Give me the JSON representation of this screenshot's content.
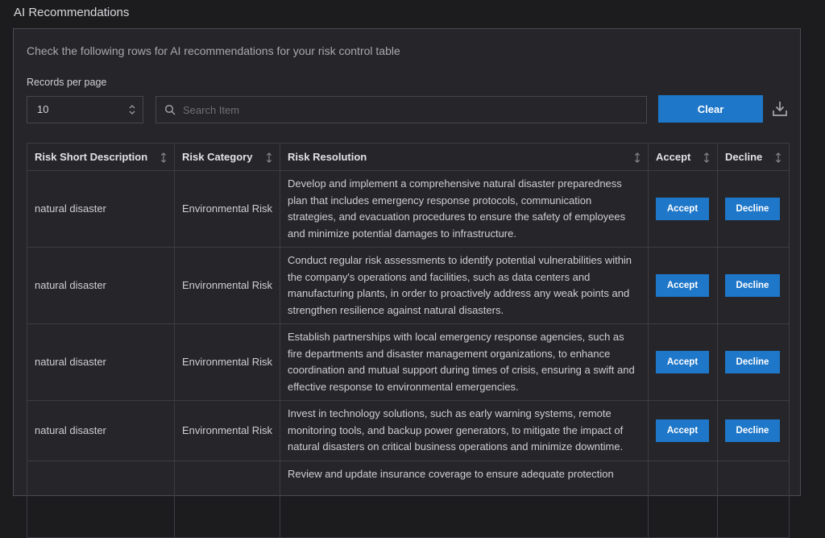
{
  "page": {
    "title": "AI Recommendations"
  },
  "panel": {
    "instructions": "Check the following rows for AI recommendations for your risk control table",
    "records_per_page": {
      "label": "Records per page",
      "value": "10"
    },
    "search": {
      "placeholder": "Search Item",
      "value": ""
    },
    "clear_label": "Clear",
    "download_icon": "download-icon"
  },
  "table": {
    "headers": {
      "description": "Risk Short Description",
      "category": "Risk Category",
      "resolution": "Risk Resolution",
      "accept": "Accept",
      "decline": "Decline"
    },
    "accept_label": "Accept",
    "decline_label": "Decline",
    "rows": [
      {
        "description": "natural disaster",
        "category": "Environmental Risk",
        "resolution": "Develop and implement a comprehensive natural disaster preparedness plan that includes emergency response protocols, communication strategies, and evacuation procedures to ensure the safety of employees and minimize potential damages to infrastructure."
      },
      {
        "description": "natural disaster",
        "category": "Environmental Risk",
        "resolution": "Conduct regular risk assessments to identify potential vulnerabilities within the company's operations and facilities, such as data centers and manufacturing plants, in order to proactively address any weak points and strengthen resilience against natural disasters."
      },
      {
        "description": "natural disaster",
        "category": "Environmental Risk",
        "resolution": "Establish partnerships with local emergency response agencies, such as fire departments and disaster management organizations, to enhance coordination and mutual support during times of crisis, ensuring a swift and effective response to environmental emergencies."
      },
      {
        "description": "natural disaster",
        "category": "Environmental Risk",
        "resolution": "Invest in technology solutions, such as early warning systems, remote monitoring tools, and backup power generators, to mitigate the impact of natural disasters on critical business operations and minimize downtime."
      },
      {
        "description": "",
        "category": "",
        "resolution": "Review and update insurance coverage to ensure adequate protection"
      }
    ]
  },
  "colors": {
    "accent": "#1f77c9",
    "background": "#1c1c1f",
    "panel": "#26262a"
  }
}
